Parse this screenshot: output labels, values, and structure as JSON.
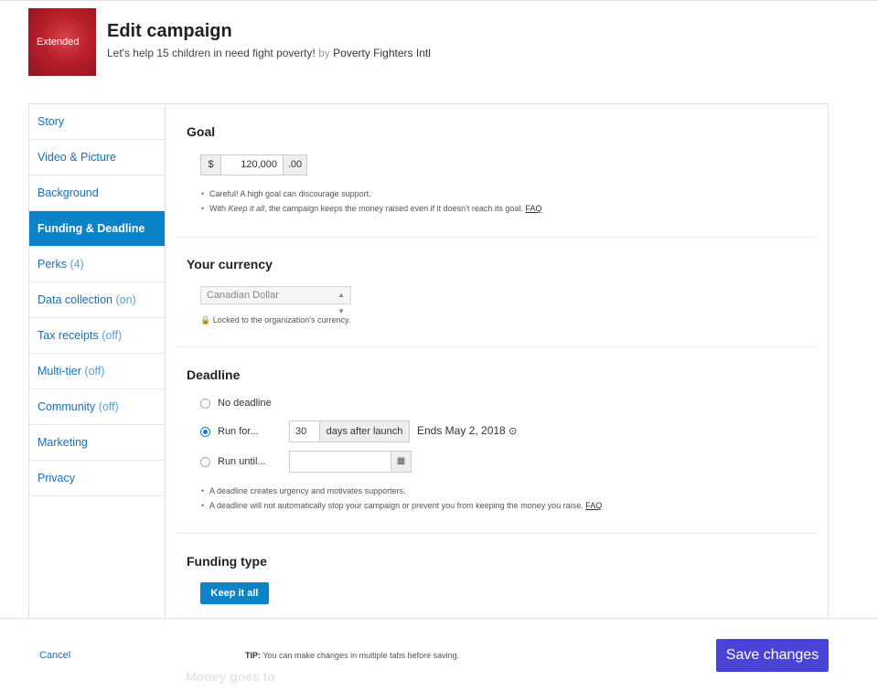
{
  "header": {
    "thumb_label": "Extended",
    "thumb_small": "",
    "title": "Edit campaign",
    "campaign_name": "Let's help 15 children in need fight poverty!",
    "by": "by",
    "organization": "Poverty Fighters Intl"
  },
  "sidebar": {
    "items": [
      {
        "label": "Story",
        "state": ""
      },
      {
        "label": "Video & Picture",
        "state": ""
      },
      {
        "label": "Background",
        "state": ""
      },
      {
        "label": "Funding & Deadline",
        "state": "",
        "active": true
      },
      {
        "label": "Perks",
        "state": "(4)"
      },
      {
        "label": "Data collection",
        "state": "(on)"
      },
      {
        "label": "Tax receipts",
        "state": "(off)"
      },
      {
        "label": "Multi-tier",
        "state": "(off)"
      },
      {
        "label": "Community",
        "state": "(off)"
      },
      {
        "label": "Marketing",
        "state": ""
      },
      {
        "label": "Privacy",
        "state": ""
      }
    ]
  },
  "goal": {
    "heading": "Goal",
    "currency_symbol": "$",
    "amount": "120,000",
    "cents": ".00",
    "note1": "Careful! A high goal can discourage support.",
    "note2_prefix": "With ",
    "note2_em": "Keep it all",
    "note2_suffix": ", the campaign keeps the money raised even if it doesn't reach its goal. ",
    "faq": "FAQ"
  },
  "currency": {
    "heading": "Your currency",
    "selected": "Canadian Dollar",
    "locked_note": "Locked to the organization's currency."
  },
  "deadline": {
    "heading": "Deadline",
    "option_none": "No deadline",
    "option_run_for": "Run for...",
    "option_run_until": "Run until...",
    "days_value": "30",
    "days_unit": "days after launch",
    "ends_text": "Ends May 2, 2018",
    "date_value": "",
    "note1": "A deadline creates urgency and motivates supporters.",
    "note2": "A deadline will not automatically stop your campaign or prevent you from keeping the money you raise. ",
    "faq": "FAQ"
  },
  "funding_type": {
    "heading": "Funding type",
    "button": "Keep it all",
    "next_heading": "Money goes to"
  },
  "footer": {
    "cancel": "Cancel",
    "tip_label": "TIP:",
    "tip_text": " You can make changes in multiple tabs before saving.",
    "save": "Save changes"
  },
  "colors": {
    "accent_blue": "#0c82c8",
    "save_purple": "#4a43d8",
    "thumb_red": "#b81f2a"
  }
}
